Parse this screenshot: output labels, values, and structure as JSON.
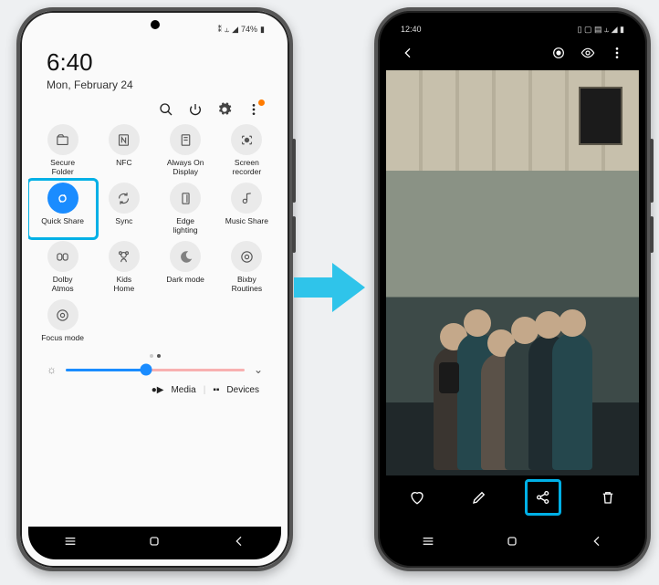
{
  "left": {
    "status": {
      "bt": "⁑",
      "wifi": "⥿",
      "sig": "◢",
      "batt_pct": "74%",
      "batt_ic": "▮"
    },
    "time": "6:40",
    "date": "Mon, February 24",
    "controls": {
      "search": "search",
      "power": "power",
      "settings": "settings",
      "more": "more"
    },
    "tiles": [
      {
        "label": "Secure\nFolder",
        "icon": "folder",
        "on": false
      },
      {
        "label": "NFC",
        "icon": "nfc",
        "on": false
      },
      {
        "label": "Always On\nDisplay",
        "icon": "aod",
        "on": false
      },
      {
        "label": "Screen\nrecorder",
        "icon": "rec",
        "on": false
      },
      {
        "label": "Quick Share",
        "icon": "share",
        "on": true,
        "hl": true
      },
      {
        "label": "Sync",
        "icon": "sync",
        "on": false
      },
      {
        "label": "Edge\nlighting",
        "icon": "edge",
        "on": false
      },
      {
        "label": "Music Share",
        "icon": "music",
        "on": false
      },
      {
        "label": "Dolby\nAtmos",
        "icon": "dolby",
        "on": false
      },
      {
        "label": "Kids\nHome",
        "icon": "kids",
        "on": false
      },
      {
        "label": "Dark mode",
        "icon": "dark",
        "on": false
      },
      {
        "label": "Bixby\nRoutines",
        "icon": "bixby",
        "on": false
      },
      {
        "label": "Focus mode",
        "icon": "focus",
        "on": false
      }
    ],
    "brightness": {
      "value": 45
    },
    "media": {
      "media": "Media",
      "devices": "Devices"
    },
    "nav": {
      "recent": "recent",
      "home": "home",
      "back": "back"
    }
  },
  "right": {
    "status": {
      "time": "12:40",
      "icons": "▯ ▢ ▤     ⥿ ◢ ▮"
    },
    "topbar": {
      "back": "back",
      "bixby": "bixby-vision",
      "visible": "visibility",
      "more": "more"
    },
    "photo": {
      "desc": "group-selfie"
    },
    "bottom": {
      "fav": "favorite",
      "edit": "edit",
      "share": "share",
      "del": "delete",
      "hl": "share"
    },
    "nav": {
      "recent": "recent",
      "home": "home",
      "back": "back"
    }
  }
}
